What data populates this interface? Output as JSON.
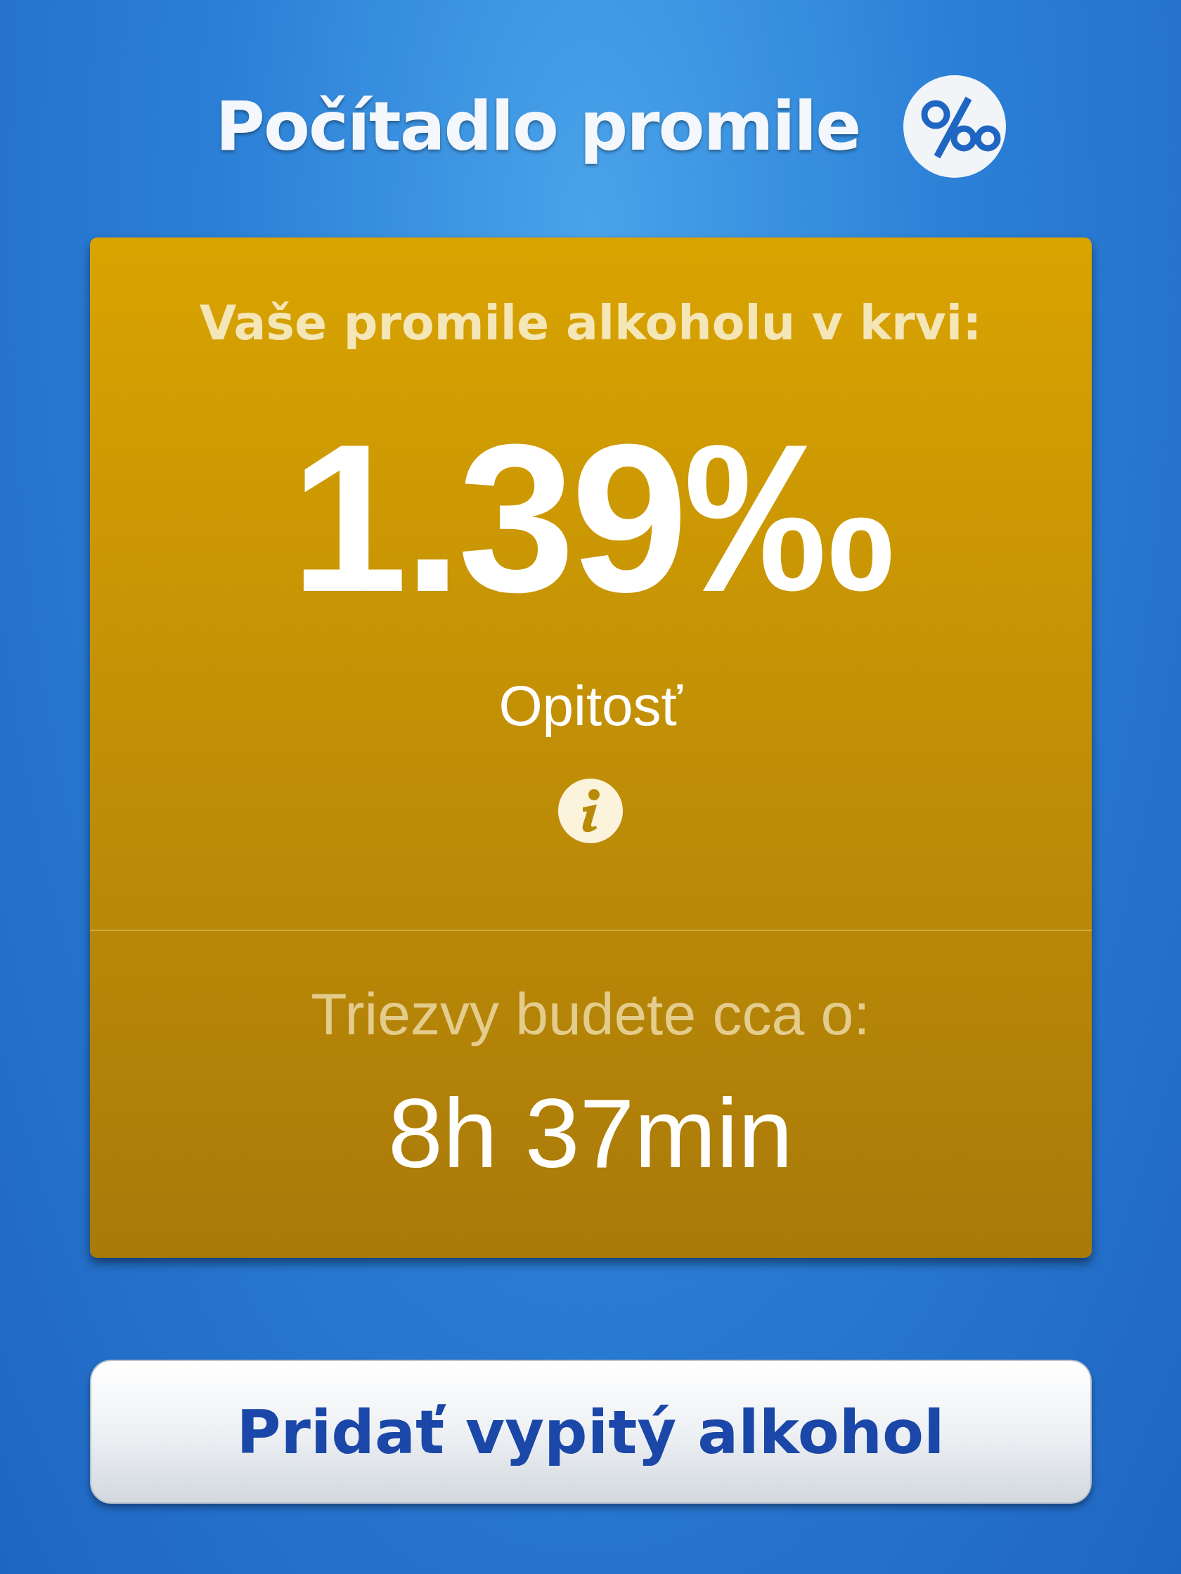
{
  "header": {
    "title": "Počítadlo promile"
  },
  "result": {
    "heading": "Vaše promile alkoholu v krvi:",
    "value": "1.39‰",
    "state": "Opitosť",
    "sober_label": "Triezvy budete cca o:",
    "sober_time": "8h 37min"
  },
  "button": {
    "label": "Pridať vypitý alkohol"
  }
}
